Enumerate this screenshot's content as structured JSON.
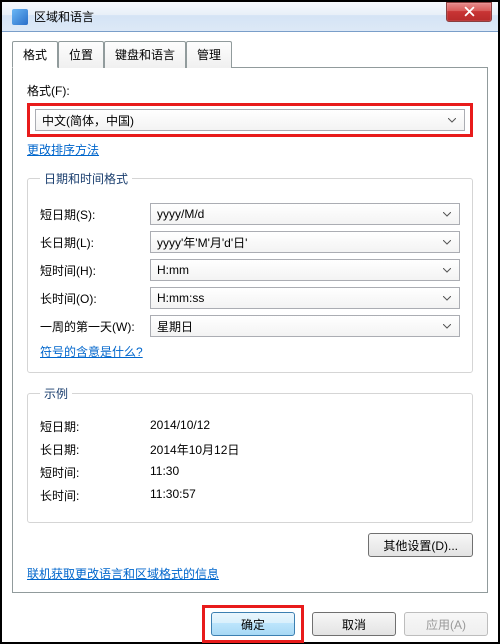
{
  "titlebar": {
    "title": "区域和语言"
  },
  "tabs": {
    "t0": "格式",
    "t1": "位置",
    "t2": "键盘和语言",
    "t3": "管理"
  },
  "format": {
    "label": "格式(F):",
    "value": "中文(简体，中国)",
    "sort_link": "更改排序方法"
  },
  "datetime": {
    "legend": "日期和时间格式",
    "short_date_label": "短日期(S):",
    "short_date_value": "yyyy/M/d",
    "long_date_label": "长日期(L):",
    "long_date_value": "yyyy'年'M'月'd'日'",
    "short_time_label": "短时间(H):",
    "short_time_value": "H:mm",
    "long_time_label": "长时间(O):",
    "long_time_value": "H:mm:ss",
    "first_day_label": "一周的第一天(W):",
    "first_day_value": "星期日",
    "symbol_link": "符号的含意是什么?"
  },
  "example": {
    "legend": "示例",
    "short_date_label": "短日期:",
    "short_date_value": "2014/10/12",
    "long_date_label": "长日期:",
    "long_date_value": "2014年10月12日",
    "short_time_label": "短时间:",
    "short_time_value": "11:30",
    "long_time_label": "长时间:",
    "long_time_value": "11:30:57"
  },
  "buttons": {
    "other_settings": "其他设置(D)...",
    "bottom_link": "联机获取更改语言和区域格式的信息",
    "ok": "确定",
    "cancel": "取消",
    "apply": "应用(A)"
  }
}
